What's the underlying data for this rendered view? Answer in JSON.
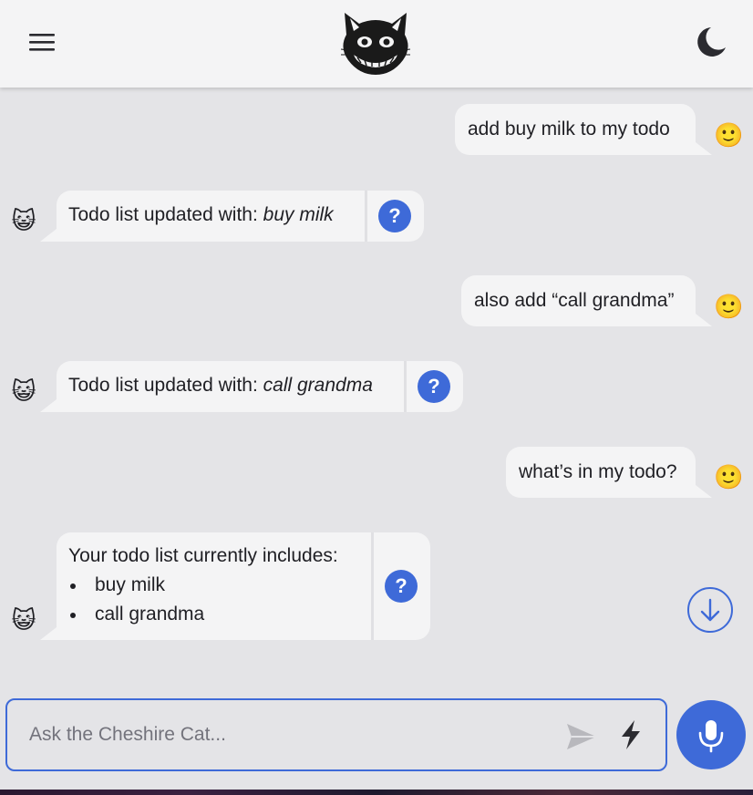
{
  "header": {
    "menu_icon": "hamburger-menu-icon",
    "logo": "cheshire-cat-logo",
    "theme_icon": "moon-icon"
  },
  "messages": [
    {
      "sender": "user",
      "text": "add buy milk to my todo",
      "avatar": "🙂"
    },
    {
      "sender": "bot",
      "prefix": "Todo list updated with: ",
      "emphasis": "buy milk",
      "avatar": "😺",
      "why": "?"
    },
    {
      "sender": "user",
      "text": "also add “call grandma”",
      "avatar": "🙂"
    },
    {
      "sender": "bot",
      "prefix": "Todo list updated with: ",
      "emphasis": "call grandma",
      "avatar": "😺",
      "why": "?"
    },
    {
      "sender": "user",
      "text": "what’s in my todo?",
      "avatar": "🙂"
    },
    {
      "sender": "bot",
      "intro": "Your todo list currently includes:",
      "items": [
        "buy milk",
        "call grandma"
      ],
      "avatar": "😺",
      "why": "?"
    }
  ],
  "input": {
    "placeholder": "Ask the Cheshire Cat...",
    "value": ""
  },
  "colors": {
    "accent": "#3e6ad8",
    "background": "#e4e4e7",
    "bubble": "#f4f4f5",
    "header": "#f4f4f5"
  }
}
